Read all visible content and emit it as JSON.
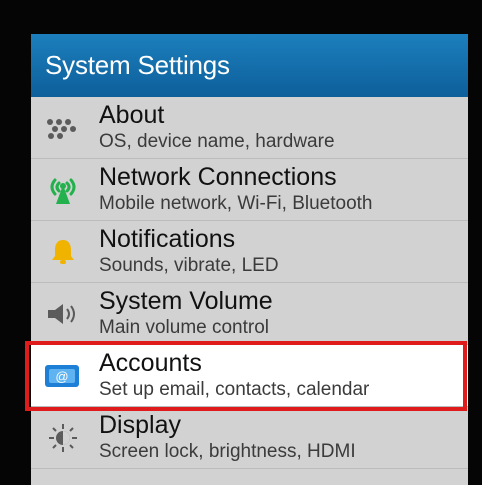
{
  "app": {
    "title": "System Settings"
  },
  "settings": {
    "items": [
      {
        "label": "About",
        "subtitle": "OS, device name, hardware",
        "icon": "blackberry-logo-icon"
      },
      {
        "label": "Network Connections",
        "subtitle": "Mobile network, Wi-Fi, Bluetooth",
        "icon": "network-antenna-icon"
      },
      {
        "label": "Notifications",
        "subtitle": "Sounds, vibrate, LED",
        "icon": "bell-icon"
      },
      {
        "label": "System Volume",
        "subtitle": "Main volume control",
        "icon": "speaker-icon"
      },
      {
        "label": "Accounts",
        "subtitle": "Set up email, contacts, calendar",
        "icon": "accounts-email-icon"
      },
      {
        "label": "Display",
        "subtitle": "Screen lock, brightness, HDMI",
        "icon": "brightness-icon"
      }
    ],
    "selected_index": 4
  },
  "colors": {
    "title_bar": "#1c7fbd",
    "list_background": "#d2d2d2",
    "highlight_border": "#e01b1b",
    "bell": "#f0b400",
    "network_green": "#22b14c",
    "accounts_blue": "#1e7fd6"
  }
}
